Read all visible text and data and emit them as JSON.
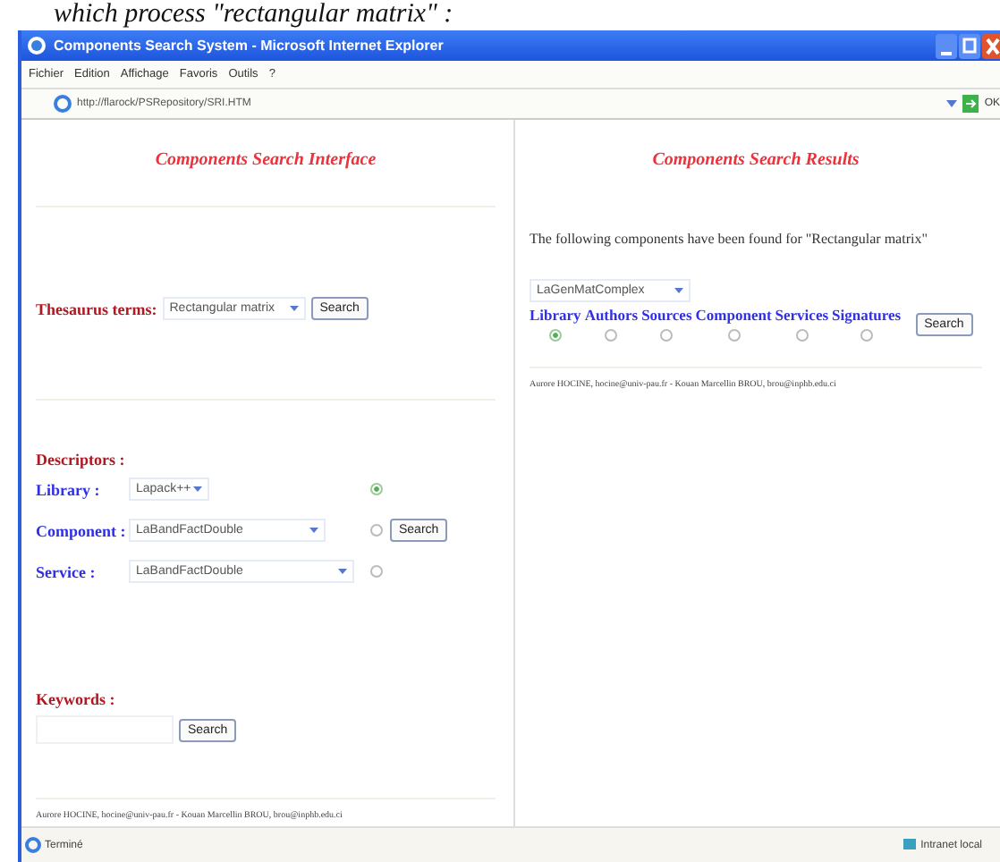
{
  "caption": "which process \"rectangular matrix\" :",
  "window": {
    "title": "Components Search System - Microsoft Internet Explorer"
  },
  "menu": [
    "Fichier",
    "Edition",
    "Affichage",
    "Favoris",
    "Outils",
    "?"
  ],
  "address": {
    "value": "http://flarock/PSRepository/SRI.HTM",
    "go": "OK"
  },
  "left": {
    "title": "Components Search Interface",
    "thesaurus": {
      "label": "Thesaurus terms:",
      "value": "Rectangular matrix",
      "button": "Search"
    },
    "descriptors_label": "Descriptors :",
    "descriptors": [
      {
        "label": "Library :",
        "value": "Lapack++",
        "selected": true
      },
      {
        "label": "Component :",
        "value": "LaBandFactDouble",
        "selected": false,
        "button": "Search"
      },
      {
        "label": "Service :",
        "value": "LaBandFactDouble",
        "selected": false
      }
    ],
    "keywords": {
      "label": "Keywords :",
      "button": "Search"
    },
    "footer": "Aurore HOCINE, hocine@univ-pau.fr - Kouan Marcellin BROU, brou@inphb.edu.ci"
  },
  "right": {
    "title": "Components Search Results",
    "message": "The following components have been found for \"Rectangular matrix\"",
    "component": "LaGenMatComplex",
    "options": [
      {
        "label": "Library",
        "selected": true
      },
      {
        "label": "Authors",
        "selected": false
      },
      {
        "label": "Sources",
        "selected": false
      },
      {
        "label": "Component",
        "selected": false
      },
      {
        "label": "Services",
        "selected": false
      },
      {
        "label": "Signatures",
        "selected": false
      }
    ],
    "button": "Search",
    "footer": "Aurore HOCINE, hocine@univ-pau.fr - Kouan Marcellin BROU, brou@inphb.edu.ci"
  },
  "status_bar": {
    "left": "Terminé",
    "right": "Intranet local"
  }
}
